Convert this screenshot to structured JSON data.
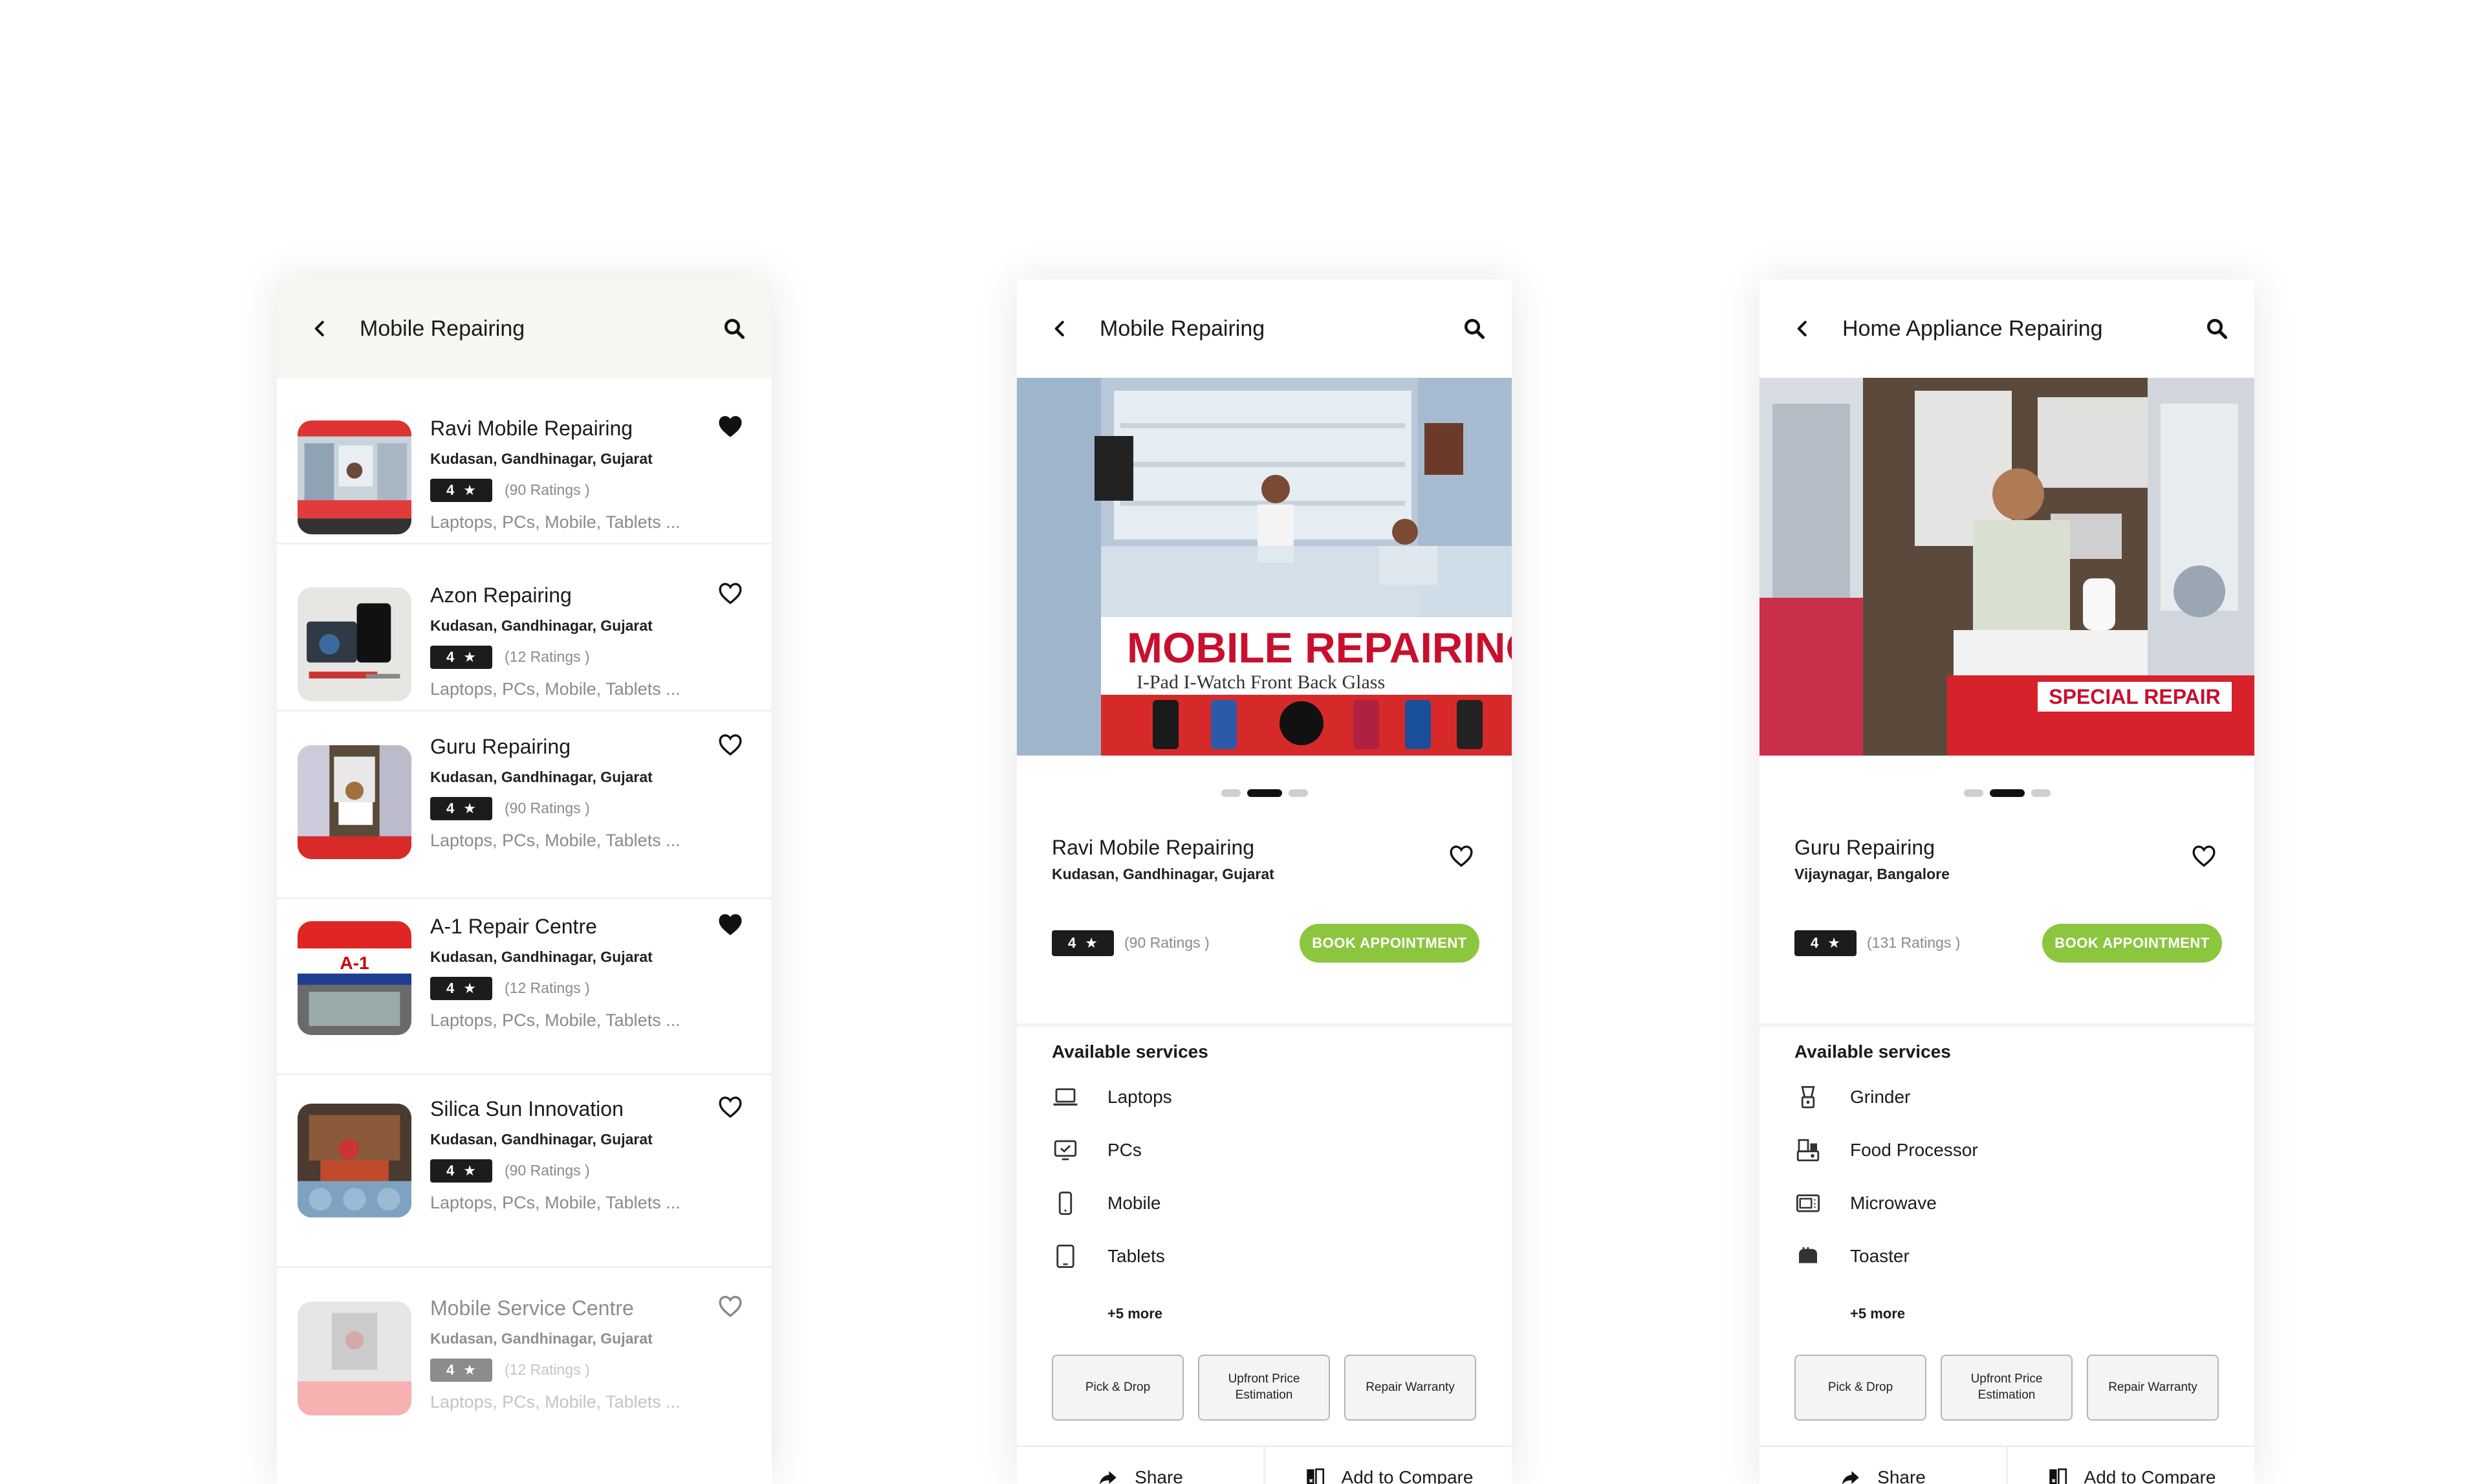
{
  "list_screen": {
    "title": "Mobile Repairing",
    "items": [
      {
        "name": "Ravi Mobile Repairing",
        "location": "Kudasan, Gandhinagar, Gujarat",
        "rating": "4",
        "ratings_text": "(90 Ratings )",
        "services": "Laptops, PCs, Mobile, Tablets ...",
        "favorite": true
      },
      {
        "name": "Azon Repairing",
        "location": "Kudasan, Gandhinagar, Gujarat",
        "rating": "4",
        "ratings_text": "(12 Ratings )",
        "services": "Laptops, PCs, Mobile, Tablets ...",
        "favorite": false
      },
      {
        "name": "Guru Repairing",
        "location": "Kudasan, Gandhinagar, Gujarat",
        "rating": "4",
        "ratings_text": "(90 Ratings )",
        "services": "Laptops, PCs, Mobile, Tablets ...",
        "favorite": false
      },
      {
        "name": "A-1 Repair Centre",
        "location": "Kudasan, Gandhinagar, Gujarat",
        "rating": "4",
        "ratings_text": "(12 Ratings )",
        "services": "Laptops, PCs, Mobile, Tablets ...",
        "favorite": true
      },
      {
        "name": "Silica Sun Innovation",
        "location": "Kudasan, Gandhinagar, Gujarat",
        "rating": "4",
        "ratings_text": "(90 Ratings )",
        "services": "Laptops, PCs, Mobile, Tablets ...",
        "favorite": false
      },
      {
        "name": "Mobile Service Centre",
        "location": "Kudasan, Gandhinagar, Gujarat",
        "rating": "4",
        "ratings_text": "(12 Ratings )",
        "services": "Laptops, PCs, Mobile, Tablets ...",
        "favorite": false
      }
    ]
  },
  "detail_mobile": {
    "title": "Mobile Repairing",
    "photo_sign": "MOBILE REPAIRING",
    "photo_subsign": "I-Pad  I-Watch  Front Back Glass",
    "shop_name": "Ravi Mobile Repairing",
    "location": "Kudasan, Gandhinagar, Gujarat",
    "rating": "4",
    "ratings_text": "(90 Ratings )",
    "book_label": "BOOK APPOINTMENT",
    "services_heading": "Available services",
    "services": [
      {
        "label": "Laptops",
        "icon": "laptop-icon"
      },
      {
        "label": "PCs",
        "icon": "pc-icon"
      },
      {
        "label": "Mobile",
        "icon": "mobile-icon"
      },
      {
        "label": "Tablets",
        "icon": "tablet-icon"
      }
    ],
    "more": "+5 more",
    "features": [
      "Pick & Drop",
      "Upfront Price Estimation",
      "Repair Warranty"
    ],
    "share_label": "Share",
    "compare_label": "Add to Compare"
  },
  "detail_appliance": {
    "title": "Home Appliance Repairing",
    "photo_sign": "SPECIAL REPAIR",
    "shop_name": "Guru Repairing",
    "location": "Vijaynagar, Bangalore",
    "rating": "4",
    "ratings_text": "(131 Ratings )",
    "book_label": "BOOK APPOINTMENT",
    "services_heading": "Available services",
    "services": [
      {
        "label": "Grinder",
        "icon": "grinder-icon"
      },
      {
        "label": "Food Processor",
        "icon": "food-processor-icon"
      },
      {
        "label": "Microwave",
        "icon": "microwave-icon"
      },
      {
        "label": "Toaster",
        "icon": "toaster-icon"
      }
    ],
    "more": "+5 more",
    "features": [
      "Pick & Drop",
      "Upfront Price Estimation",
      "Repair Warranty"
    ],
    "share_label": "Share",
    "compare_label": "Add to Compare"
  },
  "colors": {
    "accent_green": "#8cc63f",
    "badge_dark": "#1c1c1c",
    "header_bg": "#f7f6f1",
    "muted_text": "#8a8a8a"
  }
}
